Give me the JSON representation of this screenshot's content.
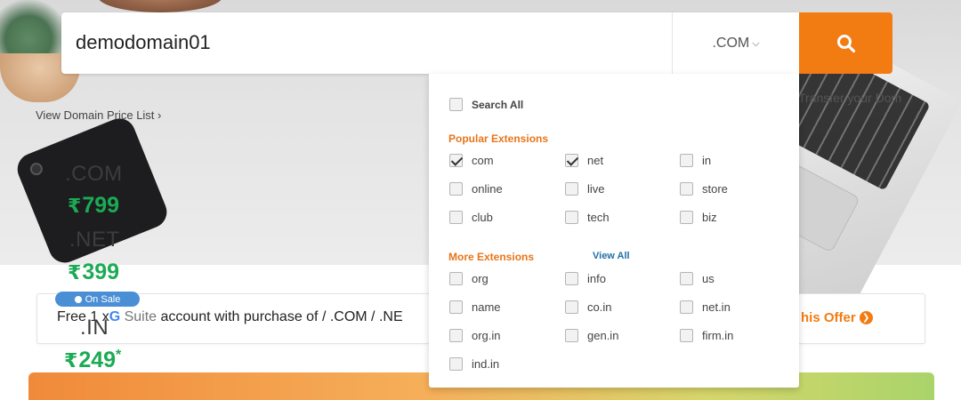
{
  "search": {
    "value": "demodomain01",
    "tld_selected": ".COM",
    "button_icon": "search-icon"
  },
  "links": {
    "price_list": "View Domain Price List",
    "transfer": "Transfer your Dom"
  },
  "prices": [
    {
      "ext": ".COM",
      "currency": "₹",
      "amount": "799"
    },
    {
      "ext": ".NET",
      "currency": "₹",
      "amount": "399"
    },
    {
      "ext": ".IN",
      "currency": "₹",
      "amount": "249",
      "mark": "*"
    }
  ],
  "offer": {
    "badge": "On Sale",
    "text_before": "Free 1 x",
    "gsuite_g": "G",
    "gsuite_word": "Suite",
    "text_after": " account with purchase of / .COM / .NE",
    "link": "his Offer"
  },
  "dropdown": {
    "search_all": {
      "label": "Search All",
      "checked": false
    },
    "popular_title": "Popular Extensions",
    "popular": [
      {
        "label": "com",
        "checked": true
      },
      {
        "label": "net",
        "checked": true
      },
      {
        "label": "in",
        "checked": false
      },
      {
        "label": "online",
        "checked": false
      },
      {
        "label": "live",
        "checked": false
      },
      {
        "label": "store",
        "checked": false
      },
      {
        "label": "club",
        "checked": false
      },
      {
        "label": "tech",
        "checked": false
      },
      {
        "label": "biz",
        "checked": false
      }
    ],
    "more_title": "More Extensions",
    "view_all": "View All",
    "more": [
      {
        "label": "org",
        "checked": false
      },
      {
        "label": "info",
        "checked": false
      },
      {
        "label": "us",
        "checked": false
      },
      {
        "label": "name",
        "checked": false
      },
      {
        "label": "co.in",
        "checked": false
      },
      {
        "label": "net.in",
        "checked": false
      },
      {
        "label": "org.in",
        "checked": false
      },
      {
        "label": "gen.in",
        "checked": false
      },
      {
        "label": "firm.in",
        "checked": false
      },
      {
        "label": "ind.in",
        "checked": false
      }
    ]
  },
  "colors": {
    "accent_orange": "#f27b12",
    "price_green": "#1bab54",
    "section_orange": "#e8761a",
    "link_blue": "#1d6fa8",
    "badge_blue": "#4a8fd6"
  }
}
